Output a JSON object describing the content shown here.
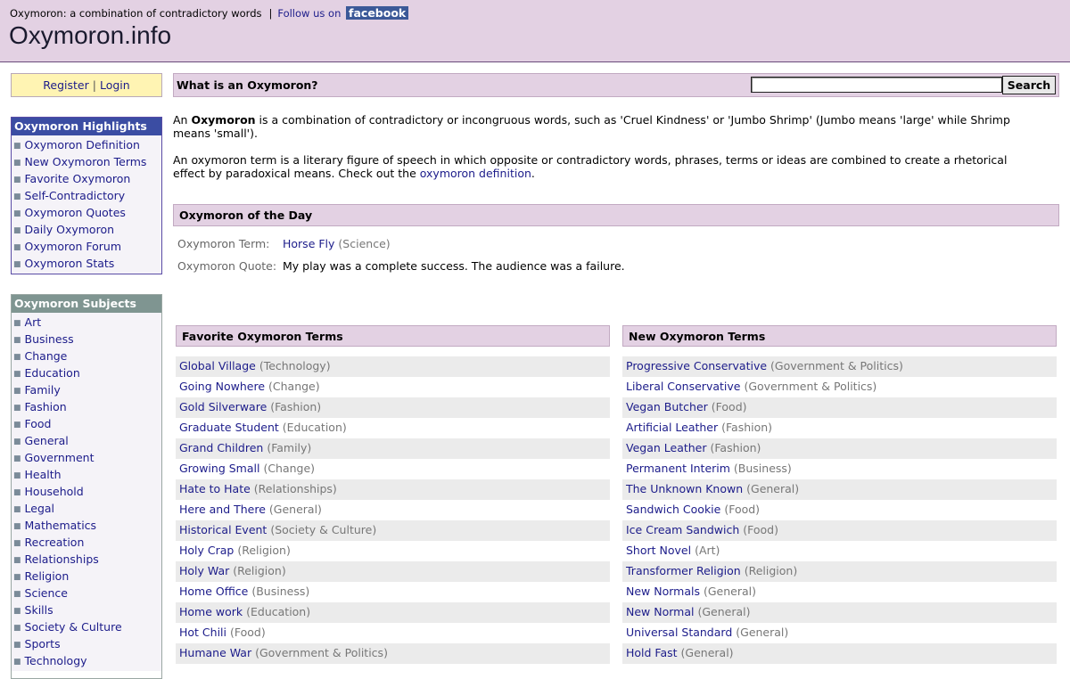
{
  "header": {
    "tagline": "Oxymoron: a combination of contradictory words",
    "separator": "|",
    "follow_text": "Follow us on",
    "facebook_label": "facebook",
    "site_title": "Oxymoron.info"
  },
  "auth": {
    "register": "Register",
    "separator": "|",
    "login": "Login"
  },
  "highlights": {
    "title": "Oxymoron Highlights",
    "items": [
      "Oxymoron Definition",
      "New Oxymoron Terms",
      "Favorite Oxymoron",
      "Self-Contradictory",
      "Oxymoron Quotes",
      "Daily Oxymoron",
      "Oxymoron Forum",
      "Oxymoron Stats"
    ]
  },
  "subjects": {
    "title": "Oxymoron Subjects",
    "items": [
      "Art",
      "Business",
      "Change",
      "Education",
      "Family",
      "Fashion",
      "Food",
      "General",
      "Government",
      "Health",
      "Household",
      "Legal",
      "Mathematics",
      "Recreation",
      "Relationships",
      "Religion",
      "Science",
      "Skills",
      "Society & Culture",
      "Sports",
      "Technology"
    ]
  },
  "search": {
    "title": "What is an Oxymoron?",
    "value": "",
    "button": "Search"
  },
  "intro": {
    "p1_pre": "An ",
    "p1_bold": "Oxymoron",
    "p1_post": " is a combination of contradictory or incongruous words, such as 'Cruel Kindness' or 'Jumbo Shrimp' (Jumbo means 'large' while Shrimp means 'small').",
    "p2_pre": "An oxymoron term is a literary figure of speech in which opposite or contradictory words, phrases, terms or ideas are combined to create a rhetorical effect by paradoxical means. Check out the ",
    "p2_link": "oxymoron definition",
    "p2_post": "."
  },
  "of_the_day": {
    "title": "Oxymoron of the Day",
    "term_label": "Oxymoron Term:",
    "term": "Horse Fly",
    "term_category": "(Science)",
    "quote_label": "Oxymoron Quote:",
    "quote": "My play was a complete success. The audience was a failure."
  },
  "favorite": {
    "title": "Favorite Oxymoron Terms",
    "items": [
      {
        "term": "Global Village",
        "category": "(Technology)"
      },
      {
        "term": "Going Nowhere",
        "category": "(Change)"
      },
      {
        "term": "Gold Silverware",
        "category": "(Fashion)"
      },
      {
        "term": "Graduate Student",
        "category": "(Education)"
      },
      {
        "term": "Grand Children",
        "category": "(Family)"
      },
      {
        "term": "Growing Small",
        "category": "(Change)"
      },
      {
        "term": "Hate to Hate",
        "category": "(Relationships)"
      },
      {
        "term": "Here and There",
        "category": "(General)"
      },
      {
        "term": "Historical Event",
        "category": "(Society & Culture)"
      },
      {
        "term": "Holy Crap",
        "category": "(Religion)"
      },
      {
        "term": "Holy War",
        "category": "(Religion)"
      },
      {
        "term": "Home Office",
        "category": "(Business)"
      },
      {
        "term": "Home work",
        "category": "(Education)"
      },
      {
        "term": "Hot Chili",
        "category": "(Food)"
      },
      {
        "term": "Humane War",
        "category": "(Government & Politics)"
      }
    ]
  },
  "newest": {
    "title": "New Oxymoron Terms",
    "items": [
      {
        "term": "Progressive Conservative",
        "category": "(Government & Politics)"
      },
      {
        "term": "Liberal Conservative",
        "category": "(Government & Politics)"
      },
      {
        "term": "Vegan Butcher",
        "category": "(Food)"
      },
      {
        "term": "Artificial Leather",
        "category": "(Fashion)"
      },
      {
        "term": "Vegan Leather",
        "category": "(Fashion)"
      },
      {
        "term": "Permanent Interim",
        "category": "(Business)"
      },
      {
        "term": "The Unknown Known",
        "category": "(General)"
      },
      {
        "term": "Sandwich Cookie",
        "category": "(Food)"
      },
      {
        "term": "Ice Cream Sandwich",
        "category": "(Food)"
      },
      {
        "term": "Short Novel",
        "category": "(Art)"
      },
      {
        "term": "Transformer Religion",
        "category": "(Religion)"
      },
      {
        "term": "New Normals",
        "category": "(General)"
      },
      {
        "term": "New Normal",
        "category": "(General)"
      },
      {
        "term": "Universal Standard",
        "category": "(General)"
      },
      {
        "term": "Hold Fast",
        "category": "(General)"
      }
    ]
  },
  "colors": {
    "header_bg": "#e3d1e3",
    "highlight_head": "#3b4da3",
    "subjects_head": "#7f9591",
    "link": "#1c1c8a",
    "facebook": "#3b5998",
    "register_bg": "#fff4b3"
  }
}
